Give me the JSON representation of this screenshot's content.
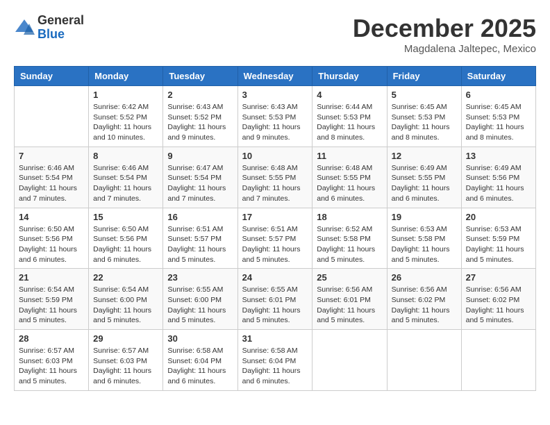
{
  "header": {
    "logo": {
      "general": "General",
      "blue": "Blue"
    },
    "title": "December 2025",
    "location": "Magdalena Jaltepec, Mexico"
  },
  "calendar": {
    "weekdays": [
      "Sunday",
      "Monday",
      "Tuesday",
      "Wednesday",
      "Thursday",
      "Friday",
      "Saturday"
    ],
    "weeks": [
      [
        {
          "day": "",
          "sunrise": "",
          "sunset": "",
          "daylight": ""
        },
        {
          "day": "1",
          "sunrise": "Sunrise: 6:42 AM",
          "sunset": "Sunset: 5:52 PM",
          "daylight": "Daylight: 11 hours and 10 minutes."
        },
        {
          "day": "2",
          "sunrise": "Sunrise: 6:43 AM",
          "sunset": "Sunset: 5:52 PM",
          "daylight": "Daylight: 11 hours and 9 minutes."
        },
        {
          "day": "3",
          "sunrise": "Sunrise: 6:43 AM",
          "sunset": "Sunset: 5:53 PM",
          "daylight": "Daylight: 11 hours and 9 minutes."
        },
        {
          "day": "4",
          "sunrise": "Sunrise: 6:44 AM",
          "sunset": "Sunset: 5:53 PM",
          "daylight": "Daylight: 11 hours and 8 minutes."
        },
        {
          "day": "5",
          "sunrise": "Sunrise: 6:45 AM",
          "sunset": "Sunset: 5:53 PM",
          "daylight": "Daylight: 11 hours and 8 minutes."
        },
        {
          "day": "6",
          "sunrise": "Sunrise: 6:45 AM",
          "sunset": "Sunset: 5:53 PM",
          "daylight": "Daylight: 11 hours and 8 minutes."
        }
      ],
      [
        {
          "day": "7",
          "sunrise": "Sunrise: 6:46 AM",
          "sunset": "Sunset: 5:54 PM",
          "daylight": "Daylight: 11 hours and 7 minutes."
        },
        {
          "day": "8",
          "sunrise": "Sunrise: 6:46 AM",
          "sunset": "Sunset: 5:54 PM",
          "daylight": "Daylight: 11 hours and 7 minutes."
        },
        {
          "day": "9",
          "sunrise": "Sunrise: 6:47 AM",
          "sunset": "Sunset: 5:54 PM",
          "daylight": "Daylight: 11 hours and 7 minutes."
        },
        {
          "day": "10",
          "sunrise": "Sunrise: 6:48 AM",
          "sunset": "Sunset: 5:55 PM",
          "daylight": "Daylight: 11 hours and 7 minutes."
        },
        {
          "day": "11",
          "sunrise": "Sunrise: 6:48 AM",
          "sunset": "Sunset: 5:55 PM",
          "daylight": "Daylight: 11 hours and 6 minutes."
        },
        {
          "day": "12",
          "sunrise": "Sunrise: 6:49 AM",
          "sunset": "Sunset: 5:55 PM",
          "daylight": "Daylight: 11 hours and 6 minutes."
        },
        {
          "day": "13",
          "sunrise": "Sunrise: 6:49 AM",
          "sunset": "Sunset: 5:56 PM",
          "daylight": "Daylight: 11 hours and 6 minutes."
        }
      ],
      [
        {
          "day": "14",
          "sunrise": "Sunrise: 6:50 AM",
          "sunset": "Sunset: 5:56 PM",
          "daylight": "Daylight: 11 hours and 6 minutes."
        },
        {
          "day": "15",
          "sunrise": "Sunrise: 6:50 AM",
          "sunset": "Sunset: 5:56 PM",
          "daylight": "Daylight: 11 hours and 6 minutes."
        },
        {
          "day": "16",
          "sunrise": "Sunrise: 6:51 AM",
          "sunset": "Sunset: 5:57 PM",
          "daylight": "Daylight: 11 hours and 5 minutes."
        },
        {
          "day": "17",
          "sunrise": "Sunrise: 6:51 AM",
          "sunset": "Sunset: 5:57 PM",
          "daylight": "Daylight: 11 hours and 5 minutes."
        },
        {
          "day": "18",
          "sunrise": "Sunrise: 6:52 AM",
          "sunset": "Sunset: 5:58 PM",
          "daylight": "Daylight: 11 hours and 5 minutes."
        },
        {
          "day": "19",
          "sunrise": "Sunrise: 6:53 AM",
          "sunset": "Sunset: 5:58 PM",
          "daylight": "Daylight: 11 hours and 5 minutes."
        },
        {
          "day": "20",
          "sunrise": "Sunrise: 6:53 AM",
          "sunset": "Sunset: 5:59 PM",
          "daylight": "Daylight: 11 hours and 5 minutes."
        }
      ],
      [
        {
          "day": "21",
          "sunrise": "Sunrise: 6:54 AM",
          "sunset": "Sunset: 5:59 PM",
          "daylight": "Daylight: 11 hours and 5 minutes."
        },
        {
          "day": "22",
          "sunrise": "Sunrise: 6:54 AM",
          "sunset": "Sunset: 6:00 PM",
          "daylight": "Daylight: 11 hours and 5 minutes."
        },
        {
          "day": "23",
          "sunrise": "Sunrise: 6:55 AM",
          "sunset": "Sunset: 6:00 PM",
          "daylight": "Daylight: 11 hours and 5 minutes."
        },
        {
          "day": "24",
          "sunrise": "Sunrise: 6:55 AM",
          "sunset": "Sunset: 6:01 PM",
          "daylight": "Daylight: 11 hours and 5 minutes."
        },
        {
          "day": "25",
          "sunrise": "Sunrise: 6:56 AM",
          "sunset": "Sunset: 6:01 PM",
          "daylight": "Daylight: 11 hours and 5 minutes."
        },
        {
          "day": "26",
          "sunrise": "Sunrise: 6:56 AM",
          "sunset": "Sunset: 6:02 PM",
          "daylight": "Daylight: 11 hours and 5 minutes."
        },
        {
          "day": "27",
          "sunrise": "Sunrise: 6:56 AM",
          "sunset": "Sunset: 6:02 PM",
          "daylight": "Daylight: 11 hours and 5 minutes."
        }
      ],
      [
        {
          "day": "28",
          "sunrise": "Sunrise: 6:57 AM",
          "sunset": "Sunset: 6:03 PM",
          "daylight": "Daylight: 11 hours and 5 minutes."
        },
        {
          "day": "29",
          "sunrise": "Sunrise: 6:57 AM",
          "sunset": "Sunset: 6:03 PM",
          "daylight": "Daylight: 11 hours and 6 minutes."
        },
        {
          "day": "30",
          "sunrise": "Sunrise: 6:58 AM",
          "sunset": "Sunset: 6:04 PM",
          "daylight": "Daylight: 11 hours and 6 minutes."
        },
        {
          "day": "31",
          "sunrise": "Sunrise: 6:58 AM",
          "sunset": "Sunset: 6:04 PM",
          "daylight": "Daylight: 11 hours and 6 minutes."
        },
        {
          "day": "",
          "sunrise": "",
          "sunset": "",
          "daylight": ""
        },
        {
          "day": "",
          "sunrise": "",
          "sunset": "",
          "daylight": ""
        },
        {
          "day": "",
          "sunrise": "",
          "sunset": "",
          "daylight": ""
        }
      ]
    ]
  }
}
